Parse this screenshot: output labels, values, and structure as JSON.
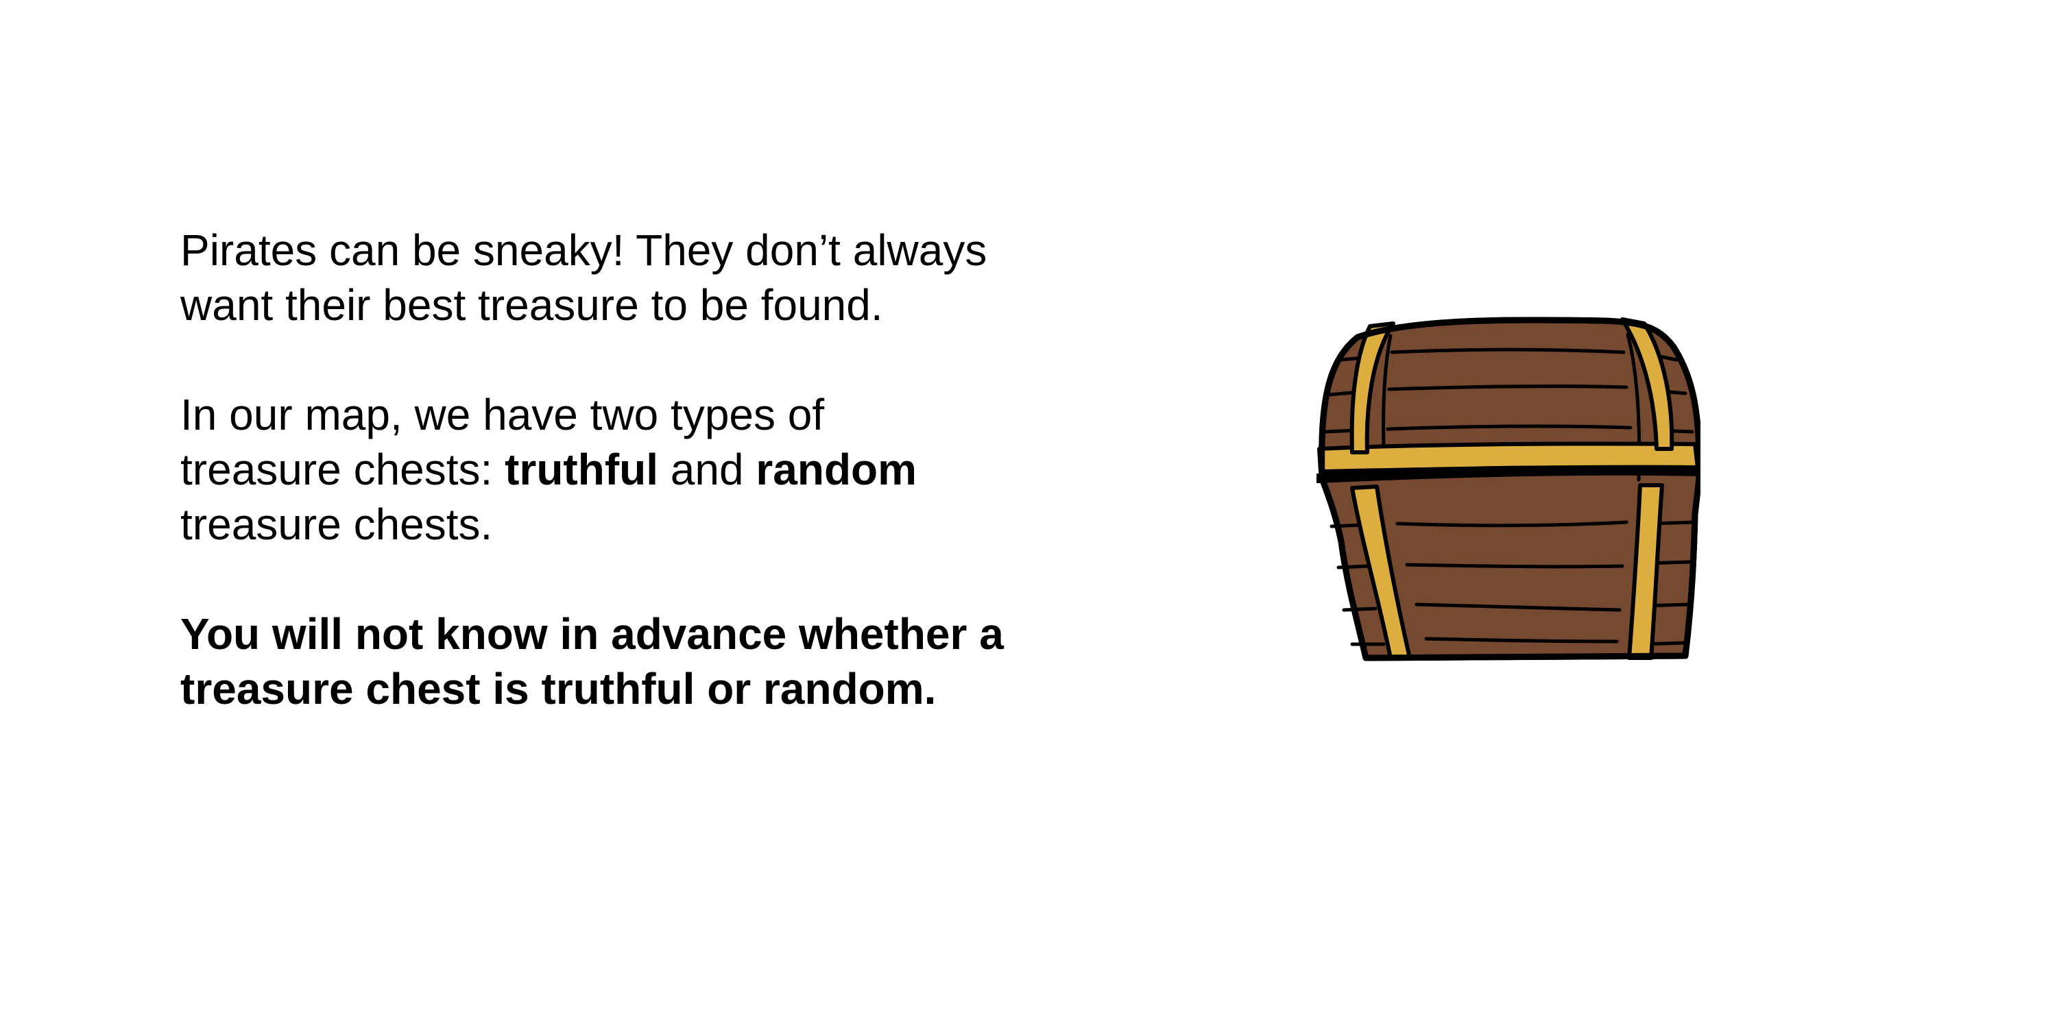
{
  "slide": {
    "para1": {
      "line1": "Pirates can be sneaky! They don’t always",
      "line2": "want their best treasure to be found."
    },
    "para2": {
      "line1": "In our map, we have two types of",
      "line2_prefix": "treasure chests: ",
      "truthful": "truthful",
      "and": " and ",
      "random": "random",
      "line3": "treasure chests."
    },
    "para3": {
      "line1": "You will not know in advance whether a",
      "line2": "treasure chest is truthful or random."
    }
  },
  "illustration": {
    "icon": "treasure-chest-icon",
    "colors": {
      "wood": "#764a30",
      "strap": "#dcae40",
      "outline": "#000000"
    }
  }
}
